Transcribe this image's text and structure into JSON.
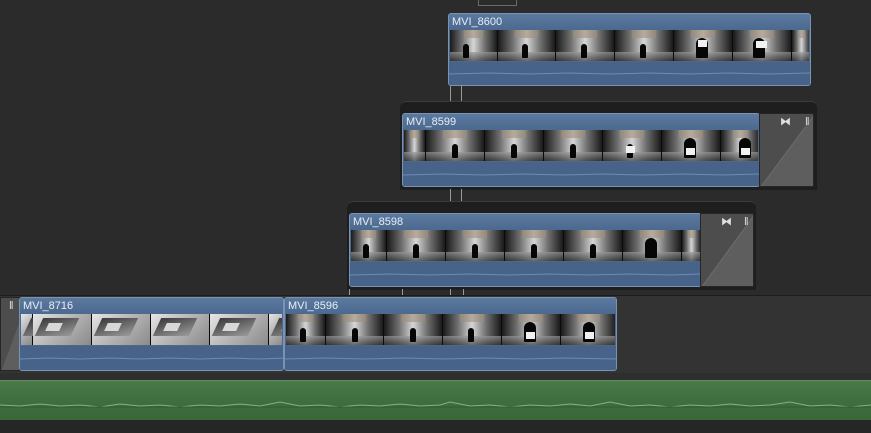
{
  "timeline": {
    "clips": [
      {
        "id": "mvi-8600",
        "label": "MVI_8600"
      },
      {
        "id": "mvi-8599",
        "label": "MVI_8599"
      },
      {
        "id": "mvi-8598",
        "label": "MVI_8598"
      },
      {
        "id": "mvi-8716",
        "label": "MVI_8716"
      },
      {
        "id": "mvi-8596",
        "label": "MVI_8596"
      }
    ]
  },
  "colors": {
    "background": "#2b2b2b",
    "clip_body": "#4d6889",
    "clip_title": "#5b7aa0",
    "audio_track": "#3f6f3f",
    "transition": "#4d4d4d"
  },
  "icons": {
    "transition": "bowtie-icon",
    "grip": "double-bar-handle-icon"
  }
}
